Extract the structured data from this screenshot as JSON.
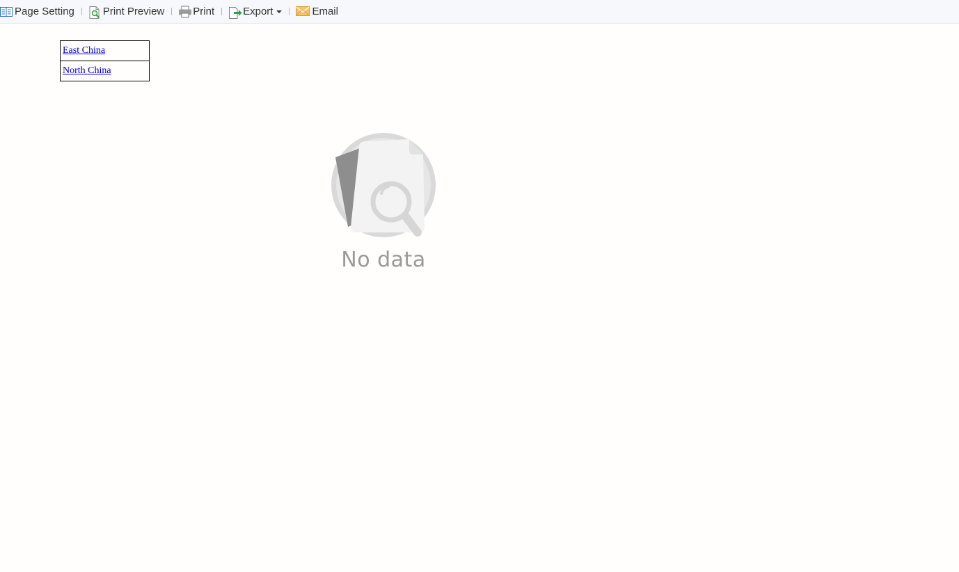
{
  "toolbar": {
    "page_setting_label": "Page Setting",
    "print_preview_label": "Print Preview",
    "print_label": "Print",
    "export_label": "Export",
    "email_label": "Email",
    "icons": {
      "page_setting": "page-setting-icon",
      "print_preview": "print-preview-icon",
      "print": "printer-icon",
      "export": "export-icon",
      "email": "envelope-icon"
    }
  },
  "report": {
    "rows": [
      {
        "label": "East China"
      },
      {
        "label": "North China"
      }
    ]
  },
  "empty_state": {
    "text": "No data",
    "icon": "no-data-illustration"
  },
  "colors": {
    "toolbar_bg": "#f7f8fb",
    "link": "#0000cc",
    "empty_text": "#9a9a9a",
    "email_icon": "#f2a93b",
    "export_icon": "#2e9e4f",
    "page_setting_icon": "#2f6fc2"
  }
}
